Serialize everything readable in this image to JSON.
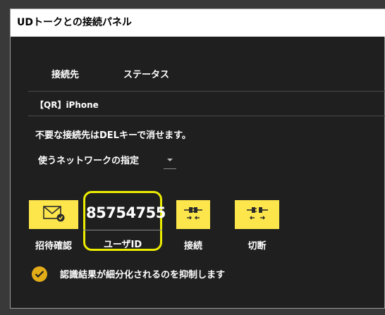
{
  "window": {
    "title": "UDトークとの接続パネル"
  },
  "tabs": {
    "connect_label": "接続先",
    "status_label": "ステータス"
  },
  "device": {
    "name": "【QR】iPhone"
  },
  "hint": {
    "text": "不要な接続先はDELキーで消せます。"
  },
  "network": {
    "label": "使うネットワークの指定",
    "selected_value": ""
  },
  "actions": {
    "invite_label": "招待確認",
    "connect_label": "接続",
    "disconnect_label": "切断"
  },
  "user": {
    "id": "85754755",
    "id_label": "ユーザID"
  },
  "option": {
    "checked": true,
    "label": "認識結果が細分化されるのを抑制します"
  },
  "colors": {
    "accent": "#fde64b",
    "highlight_border": "#ecec00",
    "check": "#e3ad19",
    "panel_bg": "#1f1f1f"
  },
  "icons": {
    "invite": "envelope-check-icon",
    "connect": "plug-connect-icon",
    "disconnect": "plug-disconnect-icon",
    "dropdown": "caret-down-icon",
    "checkbox": "checkmark-icon"
  }
}
